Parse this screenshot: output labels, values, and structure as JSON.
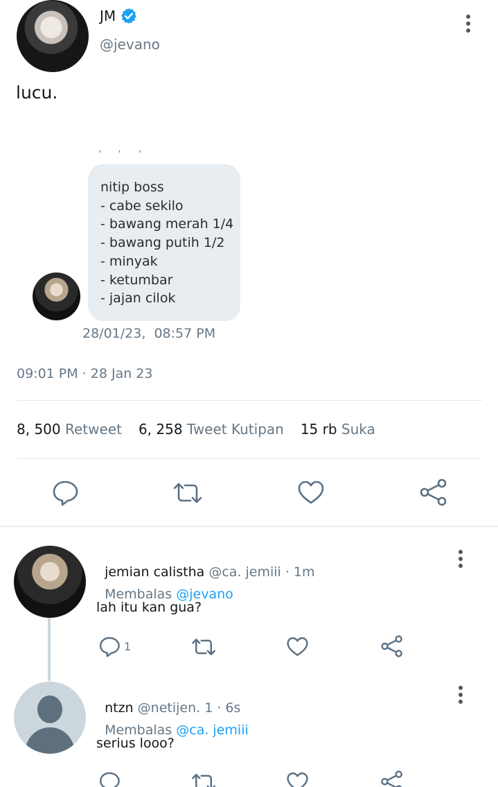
{
  "tweet": {
    "author_name": "JM",
    "author_handle": "@jevano",
    "verified_icon": "verified-badge-icon",
    "text": "lucu.",
    "time": "09:01 PM · 28 Jan 23"
  },
  "embedded": {
    "lines": [
      "nitip boss",
      "- cabe sekilo",
      "- bawang merah 1/4",
      "- bawang putih 1/2",
      "- minyak",
      "- ketumbar",
      "- jajan cilok"
    ],
    "timestamp": "28/01/23,  08:57 PM"
  },
  "stats": {
    "retweet_count": "8, 500",
    "retweet_label": "Retweet",
    "quote_count": "6, 258",
    "quote_label": "Tweet Kutipan",
    "like_count": "15 rb",
    "like_label": "Suka"
  },
  "replies": [
    {
      "name": "jemian calistha",
      "handle": "@ca. jemiii",
      "age": "· 1m",
      "replying_prefix": "Membalas",
      "replying_to": "@jevano",
      "text": "lah itu kan gua?",
      "reply_count": "1"
    },
    {
      "name": "ntzn",
      "handle": "@netijen. 1",
      "age": "· 6s",
      "replying_prefix": "Membalas",
      "replying_to": "@ca. jemiii",
      "text": "serius looo?",
      "reply_count": ""
    }
  ],
  "colors": {
    "accent": "#1da1f2",
    "secondary_text": "#657786",
    "icon": "#5b7083"
  }
}
